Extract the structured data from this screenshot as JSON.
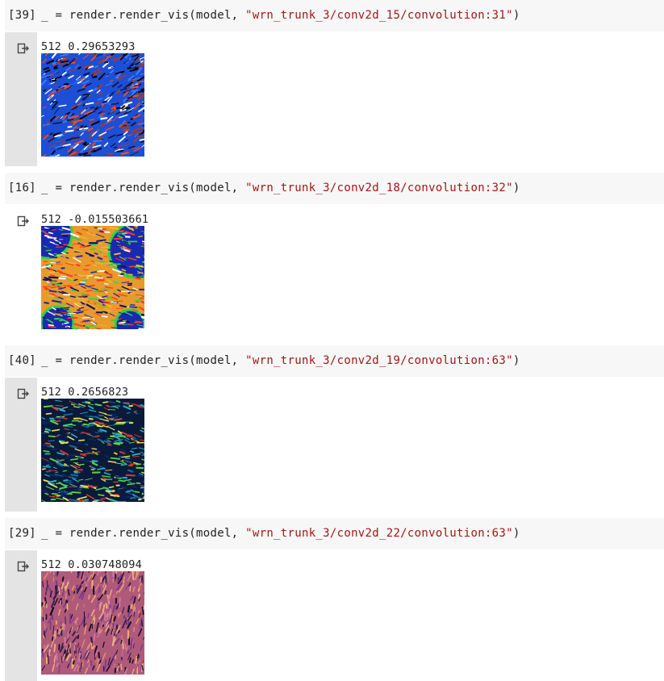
{
  "cells": [
    {
      "exec_count": "[39]",
      "code_prefix": "_ = render.render_vis(model, ",
      "code_string": "\"wrn_trunk_3/conv2d_15/convolution:31\"",
      "code_suffix": ")",
      "output_text": "512 0.29653293",
      "output_icon": "output-arrow-icon",
      "vis_palette": [
        "#1c4fd6",
        "#3b7cff",
        "#ffffff",
        "#0b1a4d",
        "#000000",
        "#b23a1a",
        "#ff4a1a"
      ]
    },
    {
      "exec_count": "[16]",
      "code_prefix": "_ = render.render_vis(model, ",
      "code_string": "\"wrn_trunk_3/conv2d_18/convolution:32\"",
      "code_suffix": ")",
      "output_text": "512 -0.015503661",
      "output_icon": "output-arrow-icon",
      "vis_palette": [
        "#e89a2a",
        "#f0b43c",
        "#0a0f6a",
        "#1a2ab0",
        "#2bd44a",
        "#ff3a20",
        "#ffffff"
      ]
    },
    {
      "exec_count": "[40]",
      "code_prefix": "_ = render.render_vis(model, ",
      "code_string": "\"wrn_trunk_3/conv2d_19/convolution:63\"",
      "code_suffix": ")",
      "output_text": "512 0.2656823",
      "output_icon": "output-arrow-icon",
      "vis_palette": [
        "#0a1a3a",
        "#1a6a9a",
        "#2ab0d0",
        "#0a2a6a",
        "#5ad04a",
        "#d03a2a",
        "#f0e05a"
      ]
    },
    {
      "exec_count": "[29]",
      "code_prefix": "_ = render.render_vis(model, ",
      "code_string": "\"wrn_trunk_3/conv2d_22/convolution:63\"",
      "code_suffix": ")",
      "output_text": "512 0.030748094",
      "output_icon": "output-arrow-icon",
      "vis_palette": [
        "#b05a7a",
        "#7a3a8a",
        "#e0906a",
        "#3a1a4a",
        "#f0b07a",
        "#1a0a2a",
        "#d07aa0"
      ]
    }
  ]
}
